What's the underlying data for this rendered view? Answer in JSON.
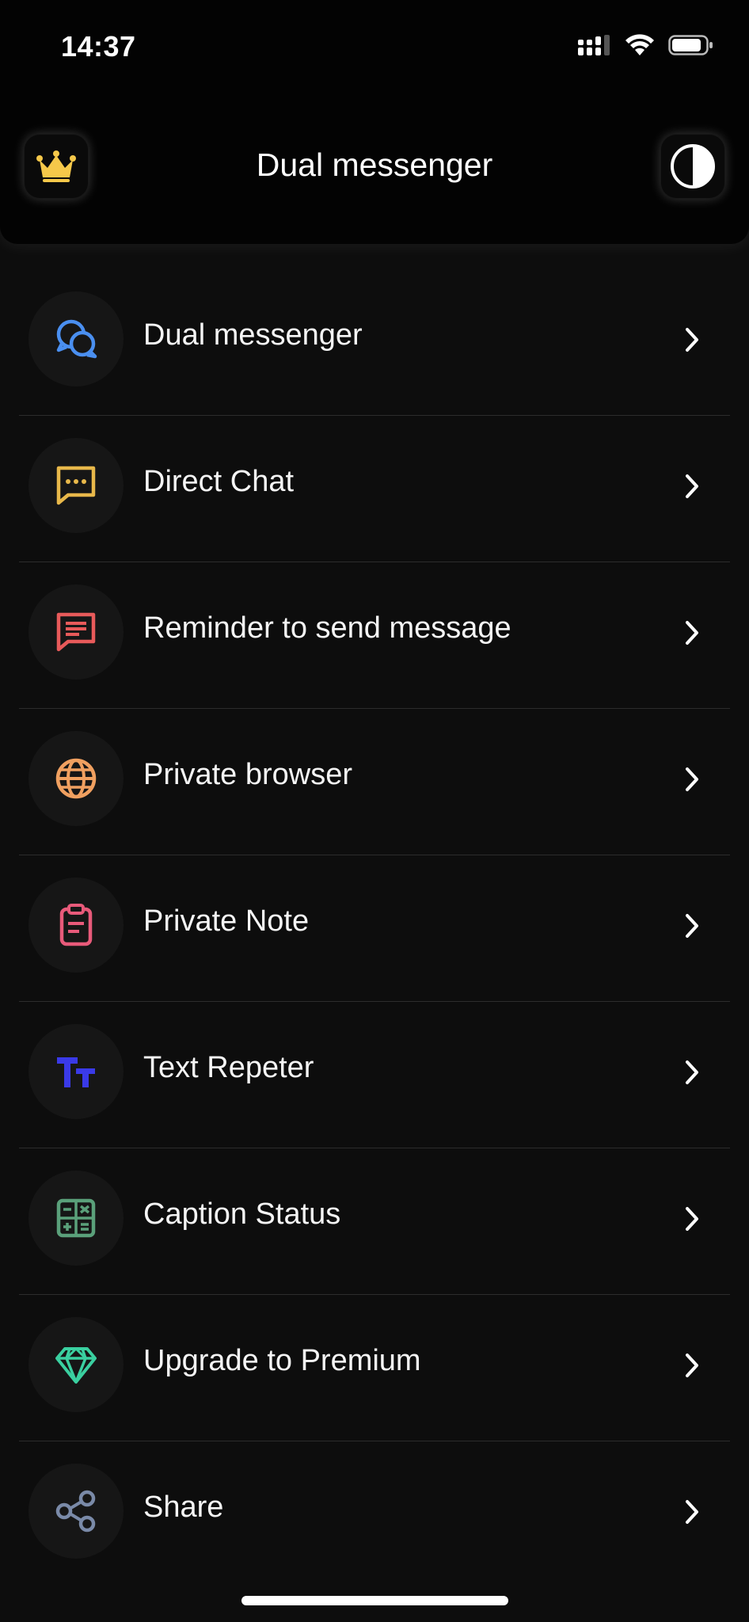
{
  "status": {
    "time": "14:37"
  },
  "header": {
    "title": "Dual messenger"
  },
  "menu": [
    {
      "label": "Dual messenger",
      "icon": "chat-bubbles-icon",
      "color": "#4a8ff0"
    },
    {
      "label": "Direct Chat",
      "icon": "message-dots-icon",
      "color": "#e8b84a"
    },
    {
      "label": "Reminder to send message",
      "icon": "message-lines-icon",
      "color": "#e85a5a"
    },
    {
      "label": "Private browser",
      "icon": "globe-icon",
      "color": "#f0a060"
    },
    {
      "label": "Private Note",
      "icon": "clipboard-icon",
      "color": "#e85a7a"
    },
    {
      "label": "Text Repeter",
      "icon": "text-size-icon",
      "color": "#3a3ae8"
    },
    {
      "label": "Caption Status",
      "icon": "calculator-icon",
      "color": "#5aa07a"
    },
    {
      "label": "Upgrade to Premium",
      "icon": "diamond-icon",
      "color": "#3ad0a0"
    },
    {
      "label": "Share",
      "icon": "share-icon",
      "color": "#7a8aa8"
    }
  ],
  "colors": {
    "crown": "#f5c84a",
    "background": "#0d0d0d"
  }
}
